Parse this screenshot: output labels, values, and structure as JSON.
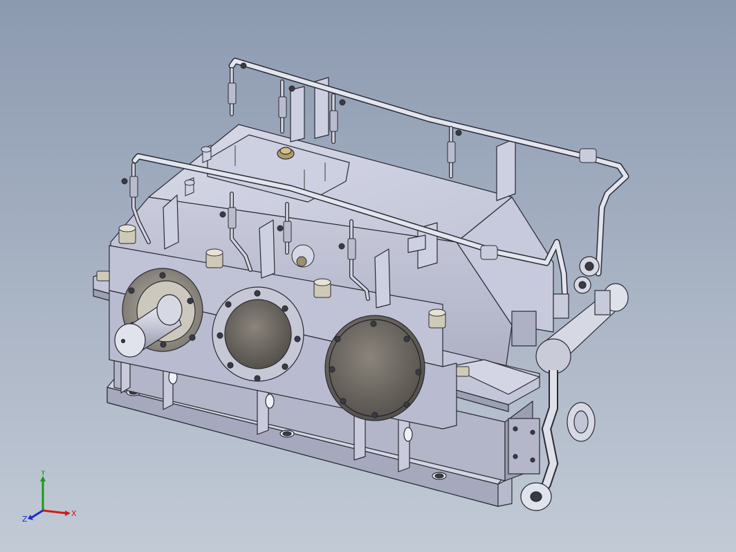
{
  "viewport": {
    "background_top": "#8c9ab0",
    "background_bottom": "#c2cad6"
  },
  "model": {
    "body_color": "#c5c8da",
    "shade_color": "#a9acc0",
    "edge_color": "#2a2a33",
    "cover_color": "#5e5a55",
    "pipe_color": "#d9dce6"
  },
  "triad": {
    "x_label": "X",
    "y_label": "Y",
    "z_label": "Z",
    "x_color": "#d11a1a",
    "y_color": "#1a9a1a",
    "z_color": "#1a2ad1"
  }
}
